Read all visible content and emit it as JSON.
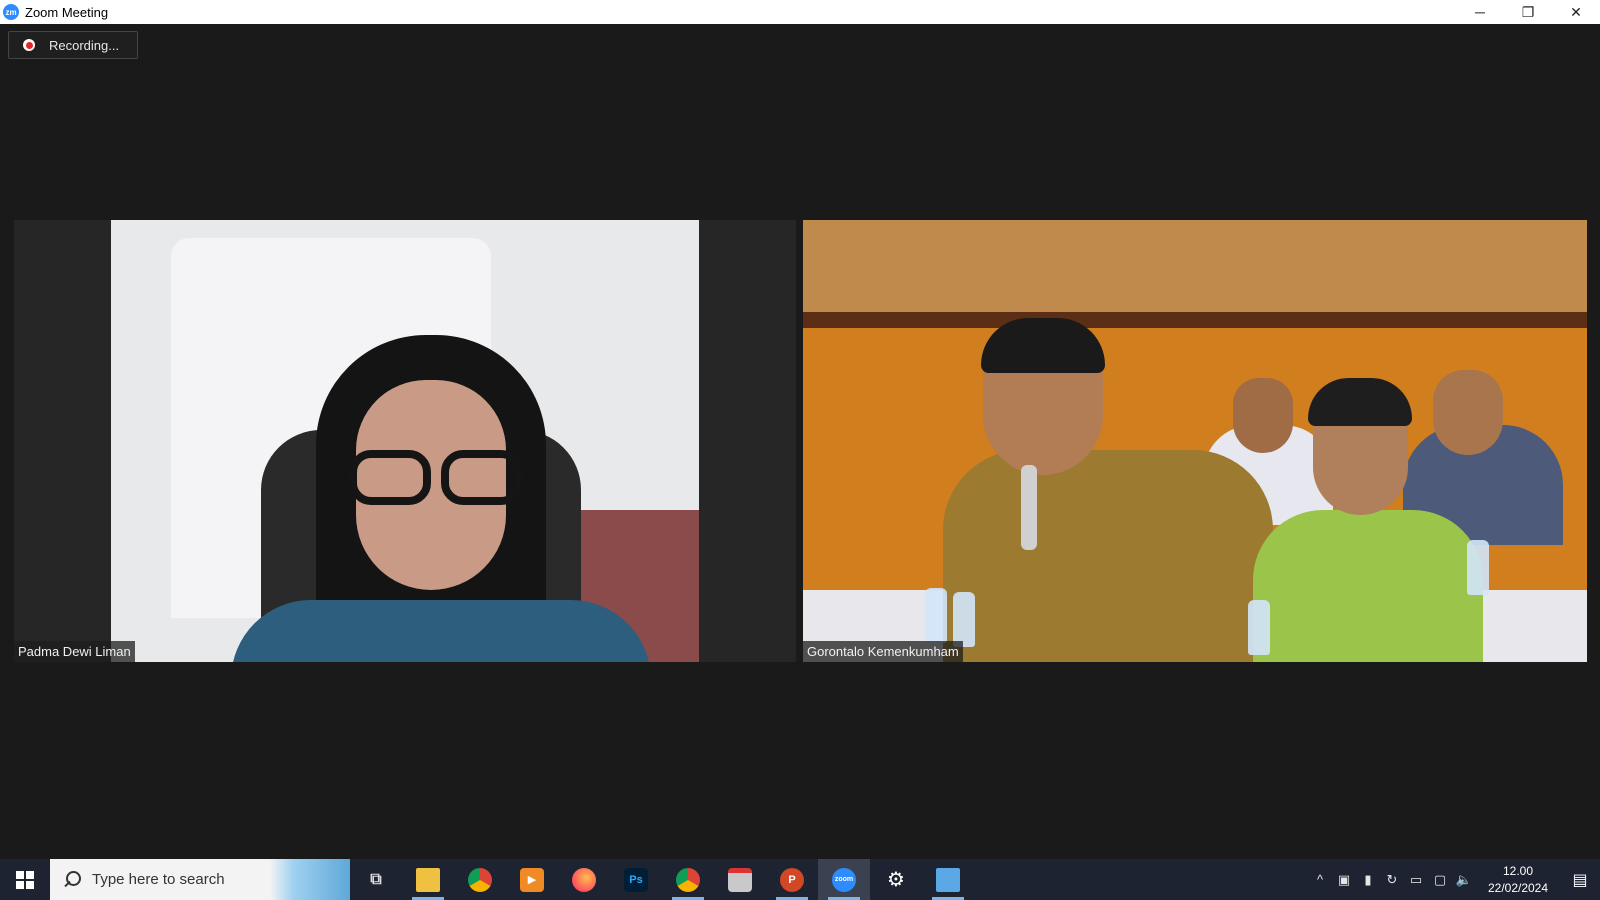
{
  "window": {
    "title": "Zoom Meeting",
    "app_icon": "zoom-icon",
    "app_icon_text": "zm",
    "controls": {
      "minimize": "─",
      "restore": "❐",
      "close": "✕"
    }
  },
  "meeting": {
    "recording_label": "Recording...",
    "participants": [
      {
        "name": "Padma Dewi Liman"
      },
      {
        "name": "Gorontalo Kemenkumham"
      }
    ]
  },
  "taskbar": {
    "search_placeholder": "Type here to search",
    "apps": [
      {
        "name": "task-view",
        "glyph": "⧉"
      },
      {
        "name": "file-explorer",
        "glyph": ""
      },
      {
        "name": "chrome",
        "glyph": ""
      },
      {
        "name": "media-player",
        "glyph": "▶"
      },
      {
        "name": "firefox",
        "glyph": ""
      },
      {
        "name": "photoshop",
        "glyph": "Ps"
      },
      {
        "name": "chrome-profile",
        "glyph": ""
      },
      {
        "name": "app-window",
        "glyph": ""
      },
      {
        "name": "powerpoint",
        "glyph": "P"
      },
      {
        "name": "zoom",
        "glyph": "zoom"
      },
      {
        "name": "settings",
        "glyph": "⚙"
      },
      {
        "name": "remote-desktop",
        "glyph": ""
      }
    ],
    "clock": {
      "time": "12.00",
      "date": "22/02/2024"
    }
  },
  "colors": {
    "zoom_blue": "#2d8cff",
    "recording_red": "#e02828",
    "taskbar_bg": "#1d2330",
    "meeting_bg": "#1a1a1a"
  }
}
